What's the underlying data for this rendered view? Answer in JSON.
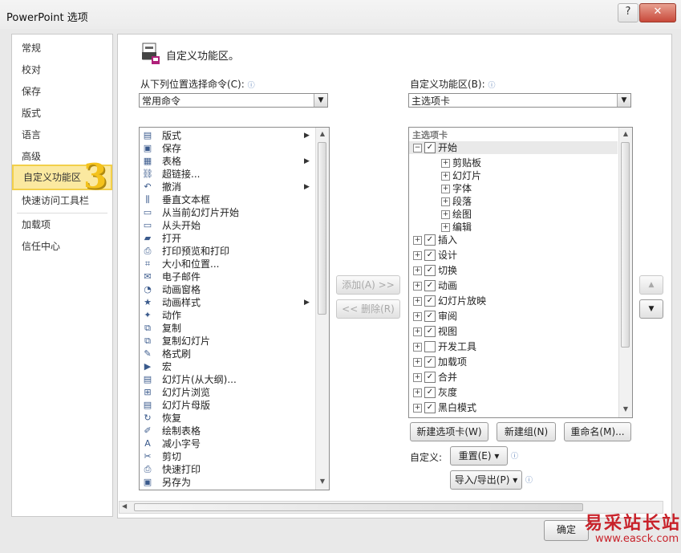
{
  "window": {
    "title": "PowerPoint 选项",
    "help_label": "?",
    "close_label": "✕"
  },
  "sidebar": {
    "items": [
      {
        "label": "常规"
      },
      {
        "label": "校对"
      },
      {
        "label": "保存"
      },
      {
        "label": "版式"
      },
      {
        "label": "语言"
      },
      {
        "label": "高级"
      },
      {
        "label": "自定义功能区"
      },
      {
        "label": "快速访问工具栏"
      },
      {
        "label": "加载项"
      },
      {
        "label": "信任中心"
      }
    ],
    "selected": "自定义功能区"
  },
  "step_badge": "3",
  "main": {
    "heading": "自定义功能区。",
    "left_label": "从下列位置选择命令(C):",
    "left_select": "常用命令",
    "right_label": "自定义功能区(B):",
    "right_select": "主选项卡",
    "commands": [
      {
        "label": "版式",
        "icon": "layout-icon",
        "sub": true
      },
      {
        "label": "保存",
        "icon": "save-icon",
        "sub": false
      },
      {
        "label": "表格",
        "icon": "table-icon",
        "sub": true
      },
      {
        "label": "超链接...",
        "icon": "hyperlink-icon",
        "sub": false
      },
      {
        "label": "撤消",
        "icon": "undo-icon",
        "sub": false,
        "split": true
      },
      {
        "label": "垂直文本框",
        "icon": "vertical-textbox-icon",
        "sub": false
      },
      {
        "label": "从当前幻灯片开始",
        "icon": "slideshow-current-icon",
        "sub": false
      },
      {
        "label": "从头开始",
        "icon": "slideshow-start-icon",
        "sub": false
      },
      {
        "label": "打开",
        "icon": "open-folder-icon",
        "sub": false
      },
      {
        "label": "打印预览和打印",
        "icon": "print-preview-icon",
        "sub": false
      },
      {
        "label": "大小和位置...",
        "icon": "size-position-icon",
        "sub": false
      },
      {
        "label": "电子邮件",
        "icon": "email-icon",
        "sub": false
      },
      {
        "label": "动画窗格",
        "icon": "animation-pane-icon",
        "sub": false
      },
      {
        "label": "动画样式",
        "icon": "animation-style-icon",
        "sub": true
      },
      {
        "label": "动作",
        "icon": "action-icon",
        "sub": false
      },
      {
        "label": "复制",
        "icon": "copy-icon",
        "sub": false
      },
      {
        "label": "复制幻灯片",
        "icon": "duplicate-slide-icon",
        "sub": false
      },
      {
        "label": "格式刷",
        "icon": "format-painter-icon",
        "sub": false
      },
      {
        "label": "宏",
        "icon": "macro-icon",
        "sub": false
      },
      {
        "label": "幻灯片(从大纲)...",
        "icon": "slides-from-outline-icon",
        "sub": false
      },
      {
        "label": "幻灯片浏览",
        "icon": "slide-sorter-icon",
        "sub": false
      },
      {
        "label": "幻灯片母版",
        "icon": "slide-master-icon",
        "sub": false
      },
      {
        "label": "恢复",
        "icon": "restore-icon",
        "sub": false
      },
      {
        "label": "绘制表格",
        "icon": "draw-table-icon",
        "sub": false
      },
      {
        "label": "减小字号",
        "icon": "decrease-font-icon",
        "sub": false
      },
      {
        "label": "剪切",
        "icon": "cut-icon",
        "sub": false
      },
      {
        "label": "快速打印",
        "icon": "quick-print-icon",
        "sub": false
      },
      {
        "label": "另存为",
        "icon": "save-as-icon",
        "sub": false
      }
    ],
    "add_button": "添加(A) >>",
    "remove_button": "<< 删除(R)",
    "tree_header": "主选项卡",
    "tree": [
      {
        "label": "开始",
        "level": 0,
        "expanded": true,
        "checked": true
      },
      {
        "label": "剪贴板",
        "level": 1
      },
      {
        "label": "幻灯片",
        "level": 1
      },
      {
        "label": "字体",
        "level": 1
      },
      {
        "label": "段落",
        "level": 1
      },
      {
        "label": "绘图",
        "level": 1
      },
      {
        "label": "编辑",
        "level": 1
      },
      {
        "label": "插入",
        "level": 0,
        "checked": true
      },
      {
        "label": "设计",
        "level": 0,
        "checked": true
      },
      {
        "label": "切换",
        "level": 0,
        "checked": true
      },
      {
        "label": "动画",
        "level": 0,
        "checked": true
      },
      {
        "label": "幻灯片放映",
        "level": 0,
        "checked": true
      },
      {
        "label": "审阅",
        "level": 0,
        "checked": true
      },
      {
        "label": "视图",
        "level": 0,
        "checked": true
      },
      {
        "label": "开发工具",
        "level": 0,
        "checked": false
      },
      {
        "label": "加载项",
        "level": 0,
        "checked": true
      },
      {
        "label": "合并",
        "level": 0,
        "checked": true
      },
      {
        "label": "灰度",
        "level": 0,
        "checked": true
      },
      {
        "label": "黑白模式",
        "level": 0,
        "checked": true
      }
    ],
    "new_tab_button": "新建选项卡(W)",
    "new_group_button": "新建组(N)",
    "rename_button": "重命名(M)...",
    "customize_label": "自定义:",
    "reset_button": "重置(E) ▾",
    "import_export_button": "导入/导出(P) ▾",
    "move_up": "▲",
    "move_down": "▼"
  },
  "ok_button": "确定",
  "watermark": {
    "text": "易采站长站",
    "url": "www.easck.com"
  },
  "colors": {
    "selected_bg": "#fbe9a0",
    "selected_border": "#f2cf4a",
    "badge": "#f4c21b"
  }
}
